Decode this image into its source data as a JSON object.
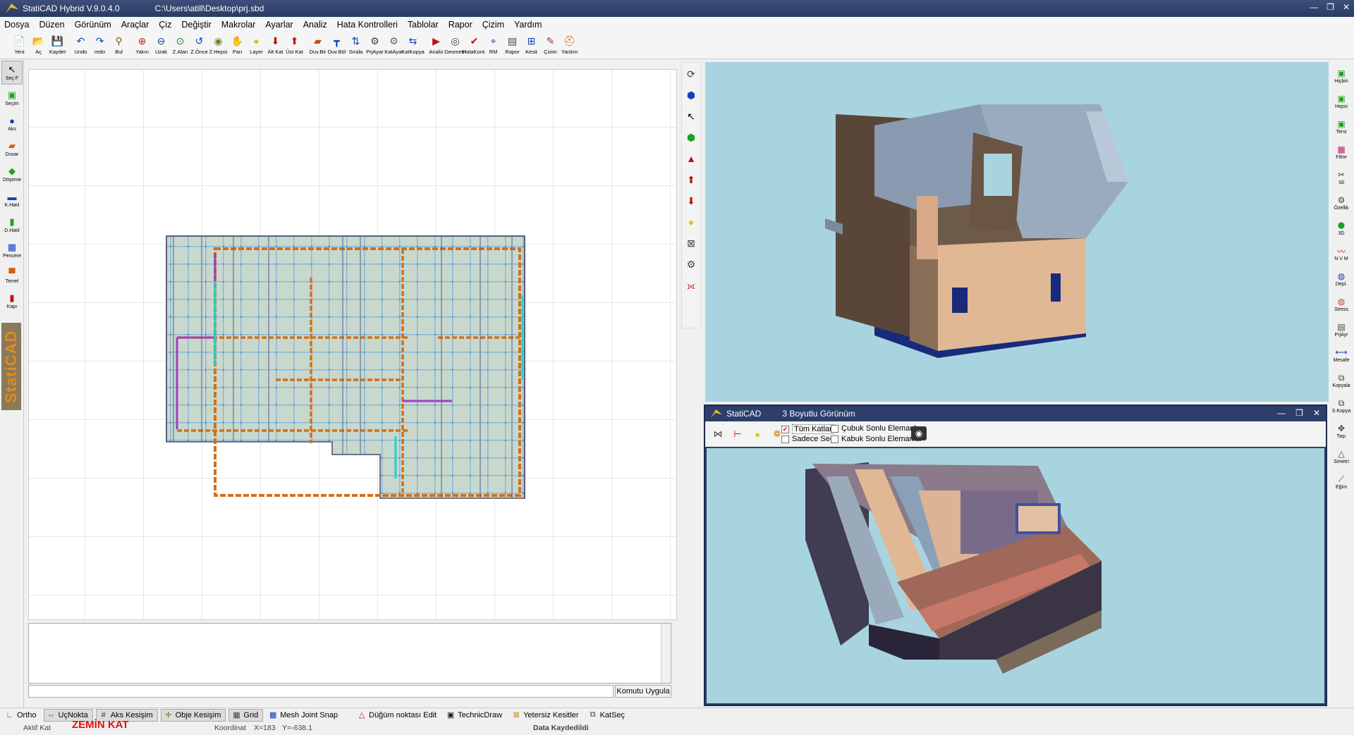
{
  "window": {
    "app_title": "StatiCAD Hybrid V.9.0.4.0",
    "file_path": "C:\\Users\\atill\\Desktop\\prj.sbd",
    "minimize": "—",
    "restore": "❐",
    "close": "✕"
  },
  "menu": [
    "Dosya",
    "Düzen",
    "Görünüm",
    "Araçlar",
    "Çiz",
    "Değiştir",
    "Makrolar",
    "Ayarlar",
    "Analiz",
    "Hata Kontrolleri",
    "Tablolar",
    "Rapor",
    "Çizim",
    "Yardım"
  ],
  "toolbar": [
    {
      "label": "Yeni",
      "icon": "new-file-icon",
      "glyph": "📄",
      "color": "#d8a020"
    },
    {
      "label": "Aç",
      "icon": "open-folder-icon",
      "glyph": "📂",
      "color": "#d8a020"
    },
    {
      "label": "Kaydet",
      "icon": "save-icon",
      "glyph": "💾",
      "color": "#202040"
    },
    {
      "sep": true
    },
    {
      "label": "Undo",
      "icon": "undo-icon",
      "glyph": "↶",
      "color": "#1040c0"
    },
    {
      "label": "redo",
      "icon": "redo-icon",
      "glyph": "↷",
      "color": "#1040c0"
    },
    {
      "label": "Bul",
      "icon": "find-icon",
      "glyph": "⚲",
      "color": "#806020"
    },
    {
      "sep": true
    },
    {
      "label": "Yakın",
      "icon": "zoom-in-icon",
      "glyph": "⊕",
      "color": "#c02020"
    },
    {
      "label": "Uzak",
      "icon": "zoom-out-icon",
      "glyph": "⊖",
      "color": "#1040c0"
    },
    {
      "label": "Z.Alan",
      "icon": "zoom-area-icon",
      "glyph": "⊙",
      "color": "#108020"
    },
    {
      "label": "Z.Önce",
      "icon": "zoom-previous-icon",
      "glyph": "↺",
      "color": "#1040c0"
    },
    {
      "label": "Z.Hepsi",
      "icon": "zoom-all-icon",
      "glyph": "◉",
      "color": "#808020"
    },
    {
      "label": "Pan",
      "icon": "pan-hand-icon",
      "glyph": "✋",
      "color": "#806020"
    },
    {
      "label": "Layer",
      "icon": "layer-bulb-icon",
      "glyph": "●",
      "color": "#e0c020"
    },
    {
      "label": "Alt Kat",
      "icon": "lower-floor-icon",
      "glyph": "⬇",
      "color": "#c01010"
    },
    {
      "label": "Üst Kat",
      "icon": "upper-floor-icon",
      "glyph": "⬆",
      "color": "#c01010"
    },
    {
      "sep": true
    },
    {
      "label": "Duv.Bir",
      "icon": "wall-join-icon",
      "glyph": "▰",
      "color": "#c05010"
    },
    {
      "label": "Duv.Böl",
      "icon": "wall-split-icon",
      "glyph": "┳",
      "color": "#1040c0"
    },
    {
      "label": "Sırala",
      "icon": "sort-icon",
      "glyph": "⇅",
      "color": "#1040c0"
    },
    {
      "label": "PrjAyar",
      "icon": "project-settings-icon",
      "glyph": "⚙",
      "color": "#404040"
    },
    {
      "label": "KatAyar",
      "icon": "floor-settings-icon",
      "glyph": "⚙",
      "color": "#606060"
    },
    {
      "label": "KatKopya",
      "icon": "floor-copy-icon",
      "glyph": "⇆",
      "color": "#1040c0"
    },
    {
      "sep": true
    },
    {
      "label": "Analiz",
      "icon": "analysis-icon",
      "glyph": "▶",
      "color": "#c01010"
    },
    {
      "label": "Geometri",
      "icon": "geometry-icon",
      "glyph": "◎",
      "color": "#404040"
    },
    {
      "label": "HataKont.",
      "icon": "error-check-icon",
      "glyph": "✔",
      "color": "#c01010"
    },
    {
      "label": "RM",
      "icon": "rigidity-center-icon",
      "glyph": "⌖",
      "color": "#1040c0"
    },
    {
      "label": "Rapor",
      "icon": "report-icon",
      "glyph": "▤",
      "color": "#404040"
    },
    {
      "label": "Kesit",
      "icon": "section-icon",
      "glyph": "⊞",
      "color": "#1040c0"
    },
    {
      "label": "Çizim",
      "icon": "drawing-icon",
      "glyph": "✎",
      "color": "#c02060"
    },
    {
      "label": "Yardım",
      "icon": "help-icon",
      "glyph": "⛑",
      "color": "#d08010"
    }
  ],
  "left_tools": [
    {
      "label": "Seç F",
      "icon": "select-arrow-icon",
      "glyph": "↖",
      "color": "#000",
      "selected": true
    },
    {
      "label": "Seçim",
      "icon": "selection-icon",
      "glyph": "▣",
      "color": "#20a020"
    },
    {
      "label": "Aks",
      "icon": "axis-icon",
      "glyph": "●",
      "color": "#1040c0"
    },
    {
      "label": "Duvar",
      "icon": "wall-icon",
      "glyph": "▰",
      "color": "#d06010"
    },
    {
      "label": "Döşeme",
      "icon": "slab-icon",
      "glyph": "◆",
      "color": "#20a020"
    },
    {
      "label": "K.Hatıl",
      "icon": "beam-icon",
      "glyph": "▬",
      "color": "#1040c0"
    },
    {
      "label": "D.Hatıl",
      "icon": "vertical-beam-icon",
      "glyph": "▮",
      "color": "#20a020"
    },
    {
      "label": "Pencere",
      "icon": "window-icon",
      "glyph": "▦",
      "color": "#1040c0"
    },
    {
      "label": "Temel",
      "icon": "foundation-icon",
      "glyph": "▀",
      "color": "#d06010"
    },
    {
      "label": "Kapı",
      "icon": "door-icon",
      "glyph": "▮",
      "color": "#c01010"
    }
  ],
  "brand_text": "StatiCAD",
  "mid_tools": [
    {
      "icon": "rotate-icon",
      "glyph": "⟳",
      "color": "#404040"
    },
    {
      "icon": "view-cube-icon",
      "glyph": "⬢",
      "color": "#1040c0"
    },
    {
      "icon": "pointer-icon",
      "glyph": "↖",
      "color": "#000"
    },
    {
      "icon": "reset-view-icon",
      "glyph": "⬢",
      "color": "#20a020"
    },
    {
      "icon": "floor-up-icon",
      "glyph": "▲",
      "color": "#c01010"
    },
    {
      "icon": "arrow-up-icon",
      "glyph": "⬆",
      "color": "#c01010"
    },
    {
      "icon": "arrow-down-icon",
      "glyph": "⬇",
      "color": "#c01010"
    },
    {
      "icon": "light-bulb-icon",
      "glyph": "●",
      "color": "#e0c020"
    },
    {
      "icon": "cut-plane-icon",
      "glyph": "⊠",
      "color": "#404040"
    },
    {
      "icon": "settings-gear-icon",
      "glyph": "⚙",
      "color": "#404040"
    },
    {
      "icon": "measure-icon",
      "glyph": "⟗",
      "color": "#c01010"
    }
  ],
  "right_tools": [
    {
      "label": "Hiçbiri",
      "icon": "select-none-icon",
      "glyph": "▣",
      "color": "#20a020"
    },
    {
      "label": "Hepsi",
      "icon": "select-all-icon",
      "glyph": "▣",
      "color": "#20a020"
    },
    {
      "label": "Tersi",
      "icon": "invert-selection-icon",
      "glyph": "▣",
      "color": "#20a020"
    },
    {
      "label": "Filtre",
      "icon": "filter-icon",
      "glyph": "▦",
      "color": "#c02060"
    },
    {
      "label": "Sil",
      "icon": "delete-icon",
      "glyph": "✂",
      "color": "#404040"
    },
    {
      "label": "Özellik",
      "icon": "properties-icon",
      "glyph": "⚙",
      "color": "#404040"
    },
    {
      "label": "3D",
      "icon": "three-d-icon",
      "glyph": "⬢",
      "color": "#20a020"
    },
    {
      "label": "N V M",
      "icon": "nvm-diagram-icon",
      "glyph": "〰",
      "color": "#c01010"
    },
    {
      "label": "Depl.",
      "icon": "displacement-icon",
      "glyph": "◍",
      "color": "#1040c0"
    },
    {
      "label": "Stress",
      "icon": "stress-icon",
      "glyph": "◍",
      "color": "#d04010"
    },
    {
      "label": "PrjAyr",
      "icon": "project-settings-icon",
      "glyph": "▤",
      "color": "#404040"
    },
    {
      "label": "Mesafe",
      "icon": "distance-icon",
      "glyph": "⟷",
      "color": "#1040c0"
    },
    {
      "label": "Kopyala",
      "icon": "copy-icon",
      "glyph": "⧉",
      "color": "#404040"
    },
    {
      "label": "S.Kopya",
      "icon": "special-copy-icon",
      "glyph": "⧉",
      "color": "#404040"
    },
    {
      "label": "Taşı",
      "icon": "move-icon",
      "glyph": "✥",
      "color": "#404040"
    },
    {
      "label": "Simetri",
      "icon": "mirror-icon",
      "glyph": "△",
      "color": "#404040"
    },
    {
      "label": "Eğim",
      "icon": "slope-icon",
      "glyph": "⟋",
      "color": "#404040"
    }
  ],
  "subwindow": {
    "app": "StatiCAD",
    "title": "3 Boyutlu Görünüm",
    "tools": [
      {
        "icon": "axis-view-icon",
        "glyph": "⋈",
        "color": "#404040"
      },
      {
        "icon": "section-cut-icon",
        "glyph": "⊢",
        "color": "#c01010"
      },
      {
        "icon": "light-icon",
        "glyph": "●",
        "color": "#e0c020"
      },
      {
        "icon": "palette-icon",
        "glyph": "❁",
        "color": "#d08010"
      }
    ],
    "checkboxes": [
      {
        "label": "Tüm Katlar",
        "checked": true
      },
      {
        "label": "Sadece Seçili",
        "checked": false
      },
      {
        "label": "Çubuk Sonlu Elemanlar",
        "checked": false
      },
      {
        "label": "Kabuk Sonlu Elemanlar",
        "checked": false
      }
    ],
    "camera_icon": "camera-icon"
  },
  "command": {
    "button": "Komutu Uygula",
    "value": ""
  },
  "status_toggles": [
    {
      "label": "Ortho",
      "icon": "ortho-icon",
      "glyph": "∟",
      "color": "#1040c0",
      "on": false
    },
    {
      "label": "UçNokta",
      "icon": "endpoint-icon",
      "glyph": "⇔",
      "color": "#c01010",
      "on": true
    },
    {
      "label": "Aks Kesişim",
      "icon": "axis-intersection-icon",
      "glyph": "#",
      "color": "#202080",
      "on": true
    },
    {
      "label": "Obje Kesişim",
      "icon": "object-intersection-icon",
      "glyph": "✛",
      "color": "#806020",
      "on": true
    },
    {
      "label": "Grid",
      "icon": "grid-icon",
      "glyph": "▦",
      "color": "#404040",
      "on": true
    },
    {
      "label": "Mesh Joint Snap",
      "icon": "mesh-snap-icon",
      "glyph": "▩",
      "color": "#1040c0",
      "on": false
    },
    {
      "label": "Düğüm noktası Edit",
      "icon": "node-edit-icon",
      "glyph": "△",
      "color": "#c01010",
      "on": false
    },
    {
      "label": "TechnicDraw",
      "icon": "technic-draw-icon",
      "glyph": "▣",
      "color": "#202020",
      "on": false
    },
    {
      "label": "Yetersiz Kesitler",
      "icon": "insufficient-sections-icon",
      "glyph": "⊠",
      "color": "#d08010",
      "on": false
    },
    {
      "label": "KatSeç",
      "icon": "floor-select-icon",
      "glyph": "⧉",
      "color": "#404040",
      "on": false
    }
  ],
  "info": {
    "active_label": "Aktif Kat",
    "active_floor": "ZEMİN KAT",
    "coord_label": "Koordinat",
    "x": "X=183",
    "y": "Y=-638.1",
    "saved": "Data Kaydedildi"
  },
  "colors": {
    "title_bar": "#2e3e6a",
    "view_bg": "#a8d4e0",
    "active_floor": "#e01010"
  }
}
